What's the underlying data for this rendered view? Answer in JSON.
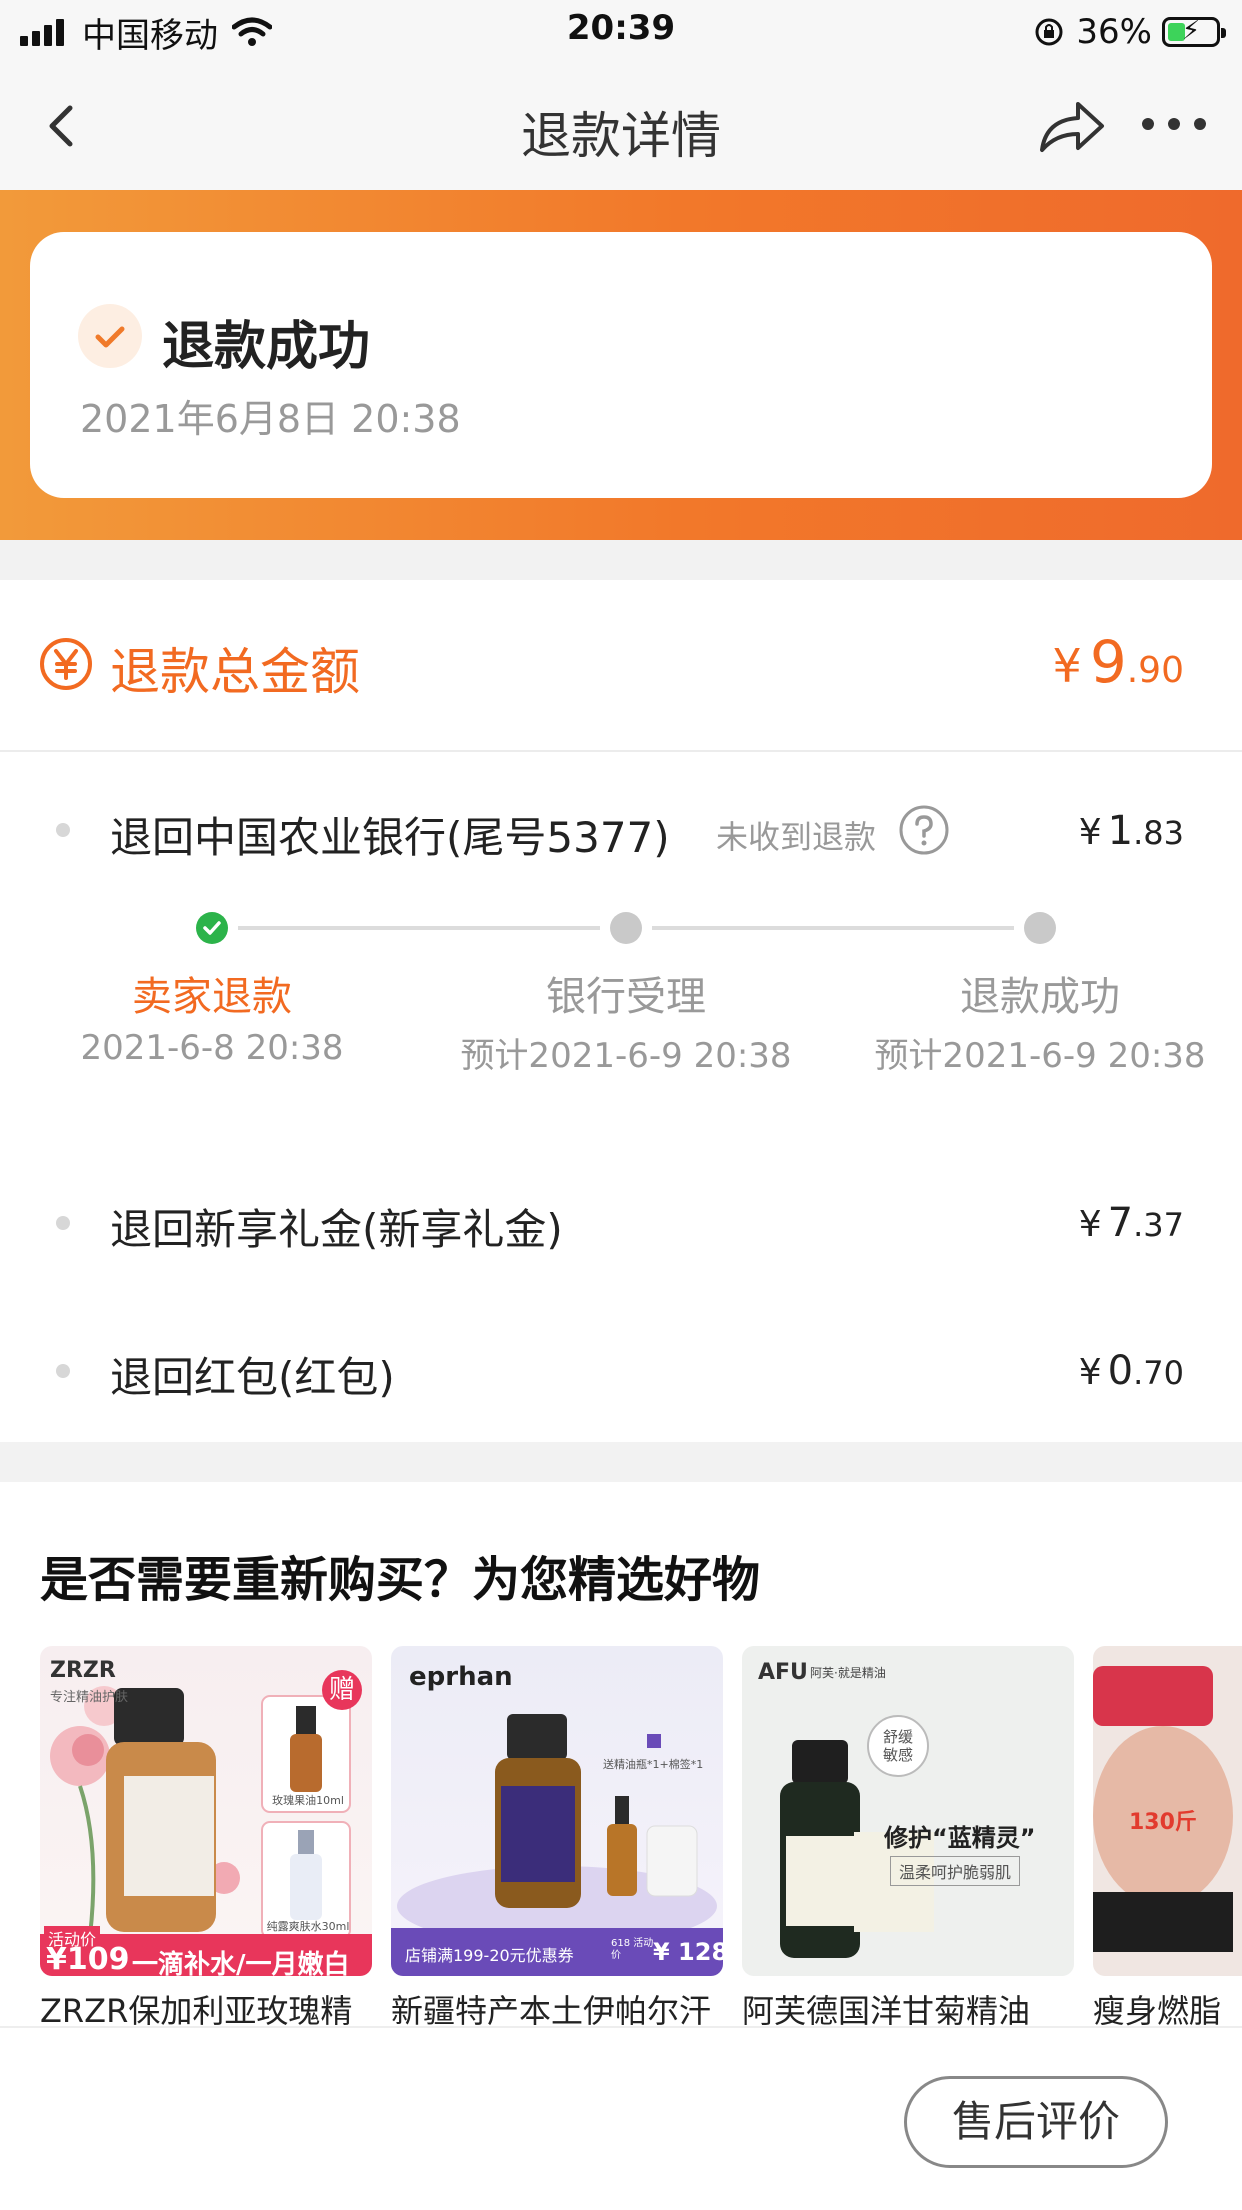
{
  "status_bar": {
    "carrier": "中国移动",
    "time": "20:39",
    "battery": "36%",
    "battery_level": 0.36
  },
  "nav": {
    "title": "退款详情",
    "back_icon": "chevron-left-icon",
    "share_icon": "share-icon",
    "more_icon": "more-icon"
  },
  "status_card": {
    "title": "退款成功",
    "time": "2021年6月8日 20:38"
  },
  "total": {
    "label": "退款总金额",
    "currency": "¥",
    "amount_int": "9",
    "amount_dec": ".90"
  },
  "refund_lines": [
    {
      "label": "退回中国农业银行(尾号5377)",
      "note": "未收到退款",
      "currency": "¥",
      "amount_int": "1",
      "amount_dec": ".83"
    },
    {
      "label": "退回新享礼金(新享礼金)",
      "currency": "¥",
      "amount_int": "7",
      "amount_dec": ".37"
    },
    {
      "label": "退回红包(红包)",
      "currency": "¥",
      "amount_int": "0",
      "amount_dec": ".70"
    }
  ],
  "progress_steps": [
    {
      "label": "卖家退款",
      "time": "2021-6-8 20:38",
      "done": true
    },
    {
      "label": "银行受理",
      "time": "预计2021-6-9 20:38",
      "done": false
    },
    {
      "label": "退款成功",
      "time": "预计2021-6-9 20:38",
      "done": false
    }
  ],
  "recommend": {
    "title": "是否需要重新购买？为您精选好物",
    "items": [
      {
        "name": "ZRZR保加利亚玫瑰精",
        "brand": "ZRZR",
        "brand_sub": "专注精油护肤",
        "gift": "赠",
        "img_text_1": "玫瑰果油10ml",
        "img_text_2": "纯露爽肤水30ml",
        "promo_label": "活动价",
        "price": "¥109",
        "slogan": "一滴补水/一月嫩白"
      },
      {
        "name": "新疆特产本土伊帕尔汗",
        "brand": "eprhan",
        "gift_note": "送精油瓶*1+棉签*1",
        "coupon": "店铺满199-20元优惠券",
        "promo_label": "618 活动价",
        "price": "¥ 128"
      },
      {
        "name": "阿芙德国洋甘菊精油",
        "brand": "AFU",
        "brand_sub": "阿芙·就是精油",
        "badge": "舒缓 敏感",
        "headline": "修护“蓝精灵”",
        "subline": "温柔呵护脆弱肌"
      },
      {
        "name": "瘦身燃脂",
        "tag": "130斤"
      }
    ]
  },
  "bottom": {
    "review_button": "售后评价"
  },
  "colors": {
    "accent": "#f26a21",
    "success": "#2cb34a",
    "hero_gradient_start": "#f29a3a",
    "hero_gradient_end": "#ef6a2c"
  }
}
